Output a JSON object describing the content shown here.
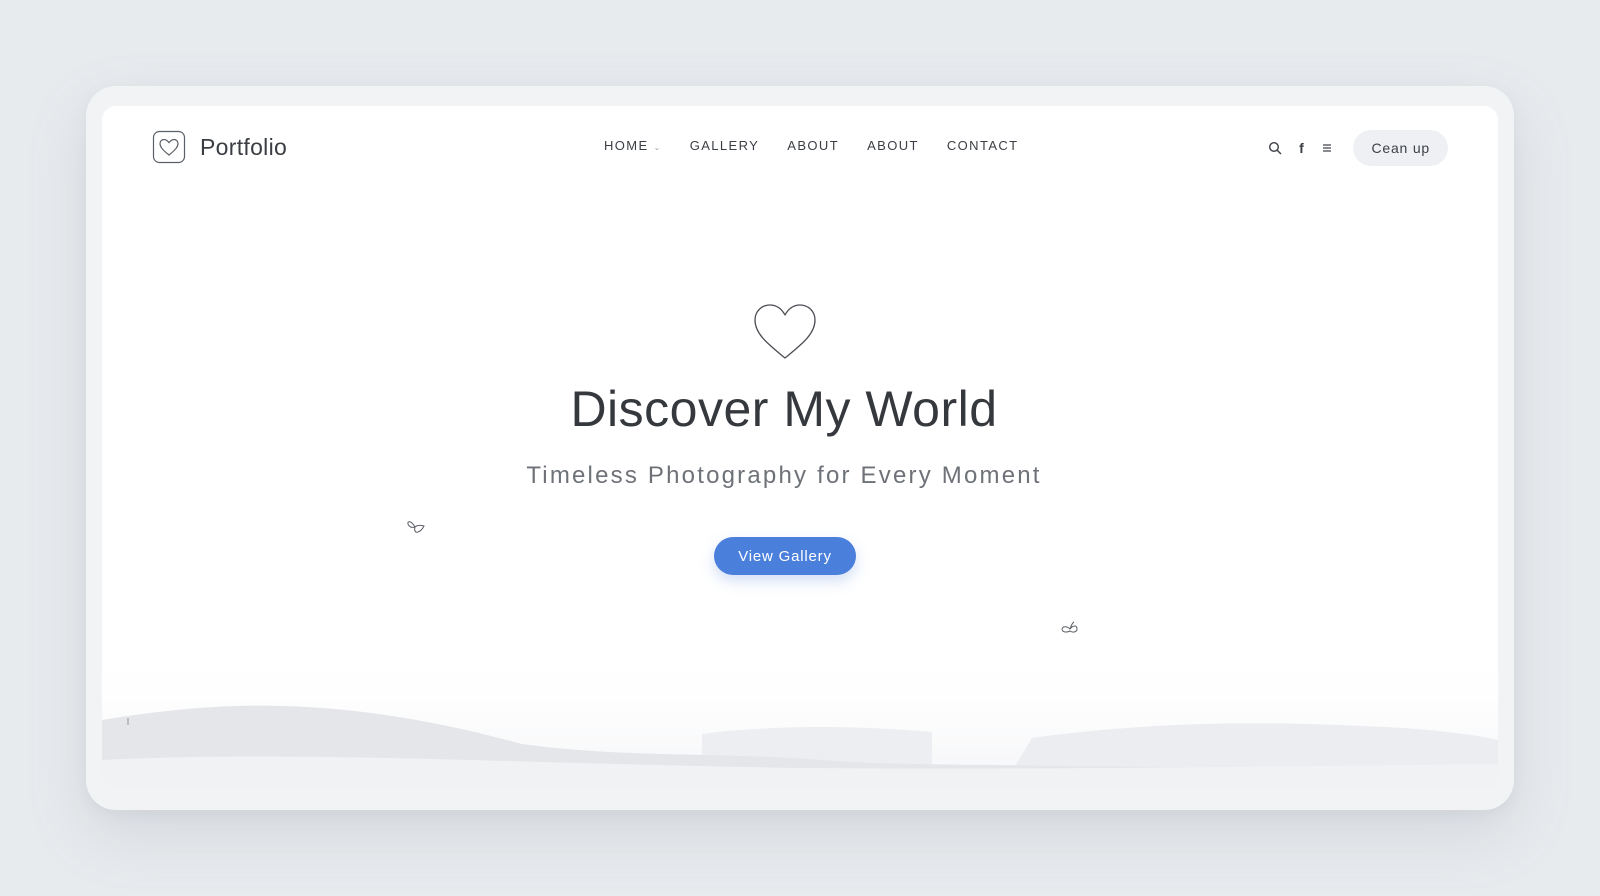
{
  "header": {
    "brand_name": "Portfolio",
    "nav": [
      {
        "label": "HOME",
        "has_dropdown": true
      },
      {
        "label": "GALLERY",
        "has_dropdown": false
      },
      {
        "label": "ABOUT",
        "has_dropdown": false
      },
      {
        "label": "ABOUT",
        "has_dropdown": false
      },
      {
        "label": "CONTACT",
        "has_dropdown": false
      }
    ],
    "icons": [
      "search-icon",
      "facebook-icon",
      "menu-icon"
    ],
    "facebook_glyph": "f",
    "action_button": "Cean up"
  },
  "hero": {
    "icon": "heart-icon",
    "title": "Discover My World",
    "subtitle": "Timeless Photography for Every Moment",
    "cta_label": "View Gallery"
  },
  "colors": {
    "accent": "#4a7fdc",
    "page_background": "#e8ebee",
    "text_dark": "#35383d",
    "text_muted": "#6e7278"
  }
}
